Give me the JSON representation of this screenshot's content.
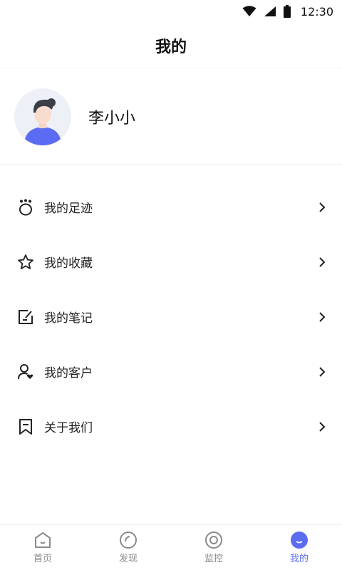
{
  "status_bar": {
    "time": "12:30"
  },
  "header": {
    "title": "我的"
  },
  "profile": {
    "name": "李小小"
  },
  "menu": {
    "items": [
      {
        "label": "我的足迹",
        "icon": "footprint-icon"
      },
      {
        "label": "我的收藏",
        "icon": "star-icon"
      },
      {
        "label": "我的笔记",
        "icon": "note-icon"
      },
      {
        "label": "我的客户",
        "icon": "customer-icon"
      },
      {
        "label": "关于我们",
        "icon": "bookmark-icon"
      }
    ]
  },
  "tabbar": {
    "tabs": [
      {
        "label": "首页",
        "icon": "home-icon",
        "active": false
      },
      {
        "label": "发现",
        "icon": "discover-icon",
        "active": false
      },
      {
        "label": "监控",
        "icon": "monitor-icon",
        "active": false
      },
      {
        "label": "我的",
        "icon": "profile-icon",
        "active": true
      }
    ]
  },
  "colors": {
    "accent": "#5b6cf2",
    "inactive": "#8a8a8a"
  }
}
